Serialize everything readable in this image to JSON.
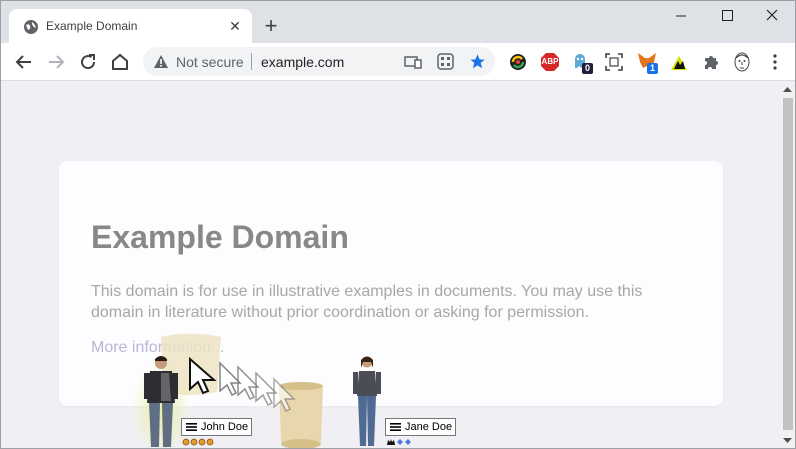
{
  "browser": {
    "tab": {
      "title": "Example Domain",
      "close": "✕"
    },
    "new_tab": "+",
    "window_controls": {
      "minimize": "—",
      "maximize": "☐",
      "close": "✕"
    },
    "omnibox": {
      "security_label": "Not secure",
      "url": "example.com"
    },
    "extensions": [
      {
        "name": "sync-ext-icon"
      },
      {
        "name": "adblock-plus-icon",
        "label": "ABP"
      },
      {
        "name": "ghostery-icon",
        "badge": "0"
      },
      {
        "name": "screenshot-icon"
      },
      {
        "name": "metamask-icon",
        "badge": "1"
      },
      {
        "name": "bug-ext-icon"
      },
      {
        "name": "extensions-puzzle-icon"
      },
      {
        "name": "profile-avatar-icon"
      },
      {
        "name": "menu-kebab-icon"
      }
    ]
  },
  "page": {
    "heading": "Example Domain",
    "paragraph": "This domain is for use in illustrative examples in documents. You may use this domain in literature without prior coordination or asking for permission.",
    "link": "More information..."
  },
  "overlay": {
    "avatars": [
      {
        "name": "John Doe"
      },
      {
        "name": "Jane Doe"
      }
    ]
  },
  "colors": {
    "tabstrip": "#dee1e6",
    "star": "#1a73e8",
    "abp_red": "#d72828",
    "page_bg": "#f0f0f4"
  }
}
